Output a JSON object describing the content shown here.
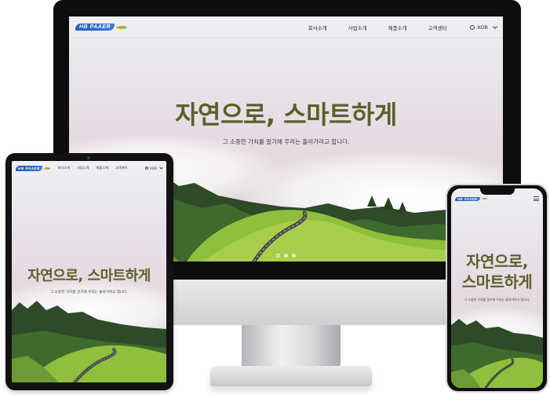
{
  "brand": {
    "logo_text": "HB PAAER"
  },
  "nav": {
    "items": [
      "회사소개",
      "사업소개",
      "제품소개",
      "고객센터"
    ],
    "lang": "KOR"
  },
  "hero": {
    "headline": "자연으로, 스마트하게",
    "headline_line1": "자연으로,",
    "headline_line2": "스마트하게",
    "subtitle": "그 소중한 가치를 알기에 우리는 돌아가려고 합니다.",
    "slide_total": 3,
    "slide_active": 1
  },
  "colors": {
    "headline": "#59602a",
    "logo_blue": "#2458b8",
    "logo_swoosh_start": "#f0a020",
    "logo_swoosh_end": "#7cc04a",
    "frame": "#0d0d0d"
  },
  "icons": {
    "language": "globe-icon",
    "dropdown": "chevron-down-icon",
    "menu": "hamburger-menu-icon"
  }
}
